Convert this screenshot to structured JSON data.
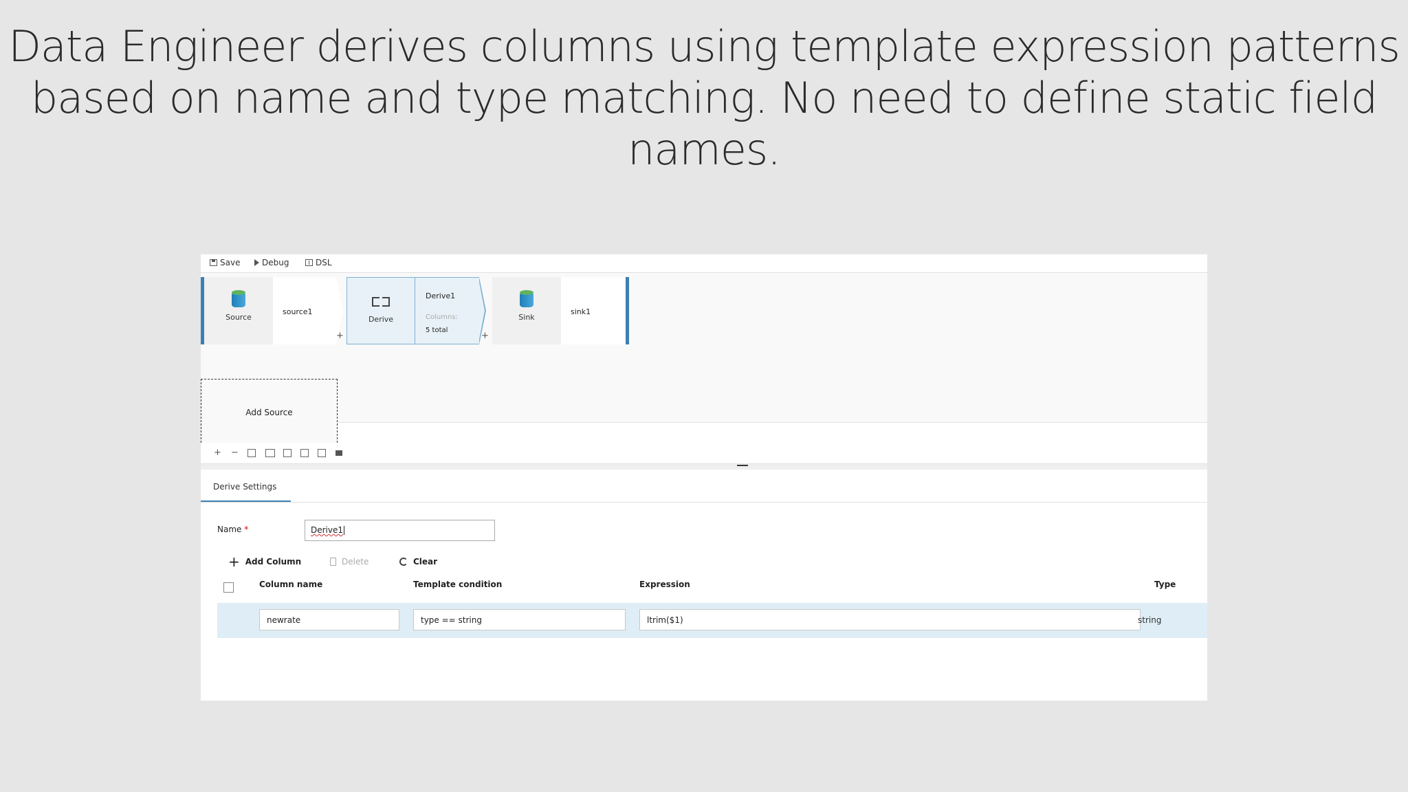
{
  "headline": {
    "line1": "Data Engineer derives columns using template expression patterns",
    "line2": "based on name and type matching. No need to define static field",
    "line3": "names."
  },
  "toolbar": {
    "save_label": "Save",
    "debug_label": "Debug",
    "dsl_label": "DSL"
  },
  "flow": {
    "source_type": "Source",
    "source_name": "source1",
    "derive_type": "Derive",
    "derive_name": "Derive1",
    "derive_columns_label": "Columns:",
    "derive_columns_count": "5 total",
    "sink_type": "Sink",
    "sink_name": "sink1",
    "plus": "+"
  },
  "canvas": {
    "add_source_label": "Add Source"
  },
  "panel": {
    "tab_label": "Derive Settings",
    "name_label": "Name",
    "name_required_mark": "*",
    "name_value": "Derive1",
    "add_column_label": "Add Column",
    "delete_label": "Delete",
    "clear_label": "Clear",
    "columns": {
      "column_name": "Column name",
      "template_condition": "Template condition",
      "expression": "Expression",
      "type": "Type"
    },
    "rows": [
      {
        "column_name": "newrate",
        "template_condition": "type == string",
        "expression": "ltrim($1)",
        "type": "string"
      }
    ]
  },
  "colors": {
    "accent": "#3c7fb3",
    "selected_row": "#deedf6",
    "selected_node": "#e7f1f7"
  }
}
